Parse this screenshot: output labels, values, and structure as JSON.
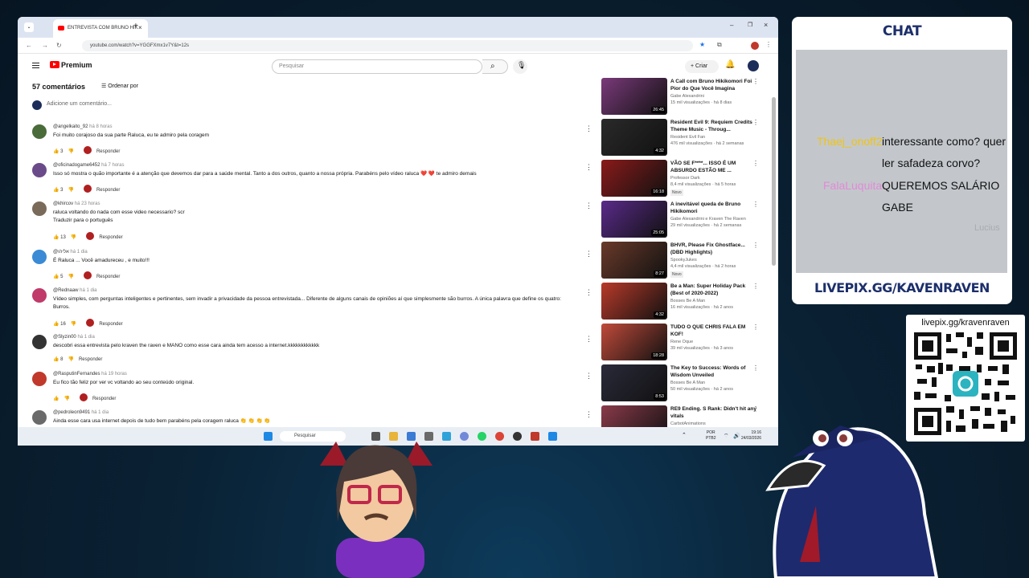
{
  "browser": {
    "tab_title": "ENTREVISTA COM BRUNO HIK",
    "url": "youtube.com/watch?v=YGGFXmx1v7Y&t=12s"
  },
  "youtube": {
    "logo": "Premium",
    "search_placeholder": "Pesquisar",
    "create_label": "Criar"
  },
  "comments": {
    "count": "57 comentários",
    "sort_label": "Ordenar por",
    "add_placeholder": "Adicione um comentário...",
    "reply_label": "Responder",
    "items": [
      {
        "user": "@angelkaito_92",
        "time": "há 8 horas",
        "text": "Foi muito corajoso da sua parte Raluca, eu te admiro pela coragem",
        "likes": "3",
        "color": "#4a6b3a"
      },
      {
        "user": "@oficinadogame6452",
        "time": "há 7 horas",
        "text": "Isso só mostra o quão importante é a atenção que devemos dar para a saúde mental. Tanto a dos outros, quanto a nossa própria. Parabéns pelo vídeo raluca ❤️ ❤️ te admiro demais",
        "likes": "3",
        "color": "#6b4a8a"
      },
      {
        "user": "@khircov",
        "time": "há 23 horas",
        "text": "raluca voltando do nada com esse video necessario? scr",
        "text2": "Traduzir para o português",
        "likes": "13",
        "color": "#7a6a5a"
      },
      {
        "user": "@אליהו",
        "time": "há 1 dia",
        "text": "É Raluca ... Você amadureceu , e muito!!!",
        "likes": "5",
        "color": "#3a8ad6"
      },
      {
        "user": "@Rednaaw",
        "time": "há 1 dia",
        "text": "Vídeo simples, com perguntas inteligentes e pertinentes, sem invadir a privacidade da pessoa entrevistada... Diferente de alguns canais de opiniões aí que simplesmente são burros. A única palavra que define os quatro:",
        "text2": "Burros.",
        "likes": "16",
        "color": "#c03a6a"
      },
      {
        "user": "@Slyzin00",
        "time": "há 1 dia",
        "text": "descobri essa entrevista pelo kraven the raven e MANO como esse cara ainda tem acesso a internet.kkkkkkkkkkkk",
        "likes": "8",
        "color": "#333"
      },
      {
        "user": "@RasputinFernandes",
        "time": "há 19 horas",
        "text": "Eu fico tão feliz por ver vc voltando ao seu conteúdo original.",
        "likes": "",
        "color": "#c0392b"
      },
      {
        "user": "@pedroleon9491",
        "time": "há 1 dia",
        "text": "Ainda esse cara usa internet depois de tudo bem parabéns pela coragem raluca 👏 👏 👏 👏",
        "likes": "",
        "color": "#6a6a6a"
      }
    ]
  },
  "sidebar": {
    "videos": [
      {
        "title": "A Call com Bruno Hikikomori Foi Pior do Que Você Imagina",
        "channel": "Gabe Alexandrini",
        "meta": "15 mil visualizações · há 8 dias",
        "duration": "26:45",
        "color": "#7a3a7a",
        "new": ""
      },
      {
        "title": "Resident Evil 9: Requiem Credits Theme Music - Throug...",
        "channel": "Resident Evil Fan",
        "meta": "476 mil visualizações · há 2 semanas",
        "duration": "4:32",
        "color": "#2a2a2a",
        "new": ""
      },
      {
        "title": "VÃO SE F****... ISSO É UM ABSURDO ESTÃO ME ...",
        "channel": "Professor Dark",
        "meta": "8,4 mil visualizações · há 5 horas",
        "duration": "16:18",
        "color": "#8a1a1a",
        "new": "Novo"
      },
      {
        "title": "A inevitável queda de Bruno Hikikomori",
        "channel": "Gabe Alexandrini e Kraven The Raven",
        "meta": "29 mil visualizações · há 2 semanas",
        "duration": "25:05",
        "color": "#5a2a8a",
        "new": ""
      },
      {
        "title": "BHVR, Please Fix Ghostface... (DBD Highlights)",
        "channel": "SpookyJukes",
        "meta": "4,4 mil visualizações · há 2 horas",
        "duration": "8:27",
        "color": "#6a3a2a",
        "new": "Novo"
      },
      {
        "title": "Be a Man: Super Holiday Pack (Best of 2020-2022)",
        "channel": "Bosses Be A Man",
        "meta": "16 mil visualizações · há 2 anos",
        "duration": "4:32",
        "color": "#b83a2a",
        "new": ""
      },
      {
        "title": "TUDO O QUE CHRIS FALA EM KOF!",
        "channel": "Rene Oque",
        "meta": "39 mil visualizações · há 3 anos",
        "duration": "18:28",
        "color": "#c04a3a",
        "new": ""
      },
      {
        "title": "The Key to Success: Words of Wisdom Unveiled",
        "channel": "Bosses Be A Man",
        "meta": "50 mil visualizações · há 2 anos",
        "duration": "8:53",
        "color": "#2a2a3a",
        "new": ""
      },
      {
        "title": "RE9 Ending. S Rank: Didn't hit any vitals",
        "channel": "CarbotAnimations",
        "meta": "",
        "duration": "",
        "color": "#8a3a4a",
        "new": ""
      }
    ]
  },
  "taskbar": {
    "search": "Pesquisar",
    "lang1": "POR",
    "lang2": "PTB2",
    "time": "19:16",
    "date": "24/03/2026"
  },
  "chat": {
    "title": "CHAT",
    "messages": [
      {
        "user": "Thaej_onoff2",
        "text1": "interessante como? quer",
        "text2": "ler safadeza corvo?"
      },
      {
        "user": "FalaLuquita",
        "text1": "QUEREMOS SALÁRIO",
        "text2": "GABE"
      }
    ],
    "faded_user": "Lucius",
    "footer": "LIVEPIX.GG/KAVENRAVEN"
  },
  "qr": {
    "label": "livepix.gg/kravenraven"
  },
  "colors": {
    "chat_accent": "#1c2f6b",
    "user1": "#f1c40f",
    "user2": "#e28ad6"
  }
}
